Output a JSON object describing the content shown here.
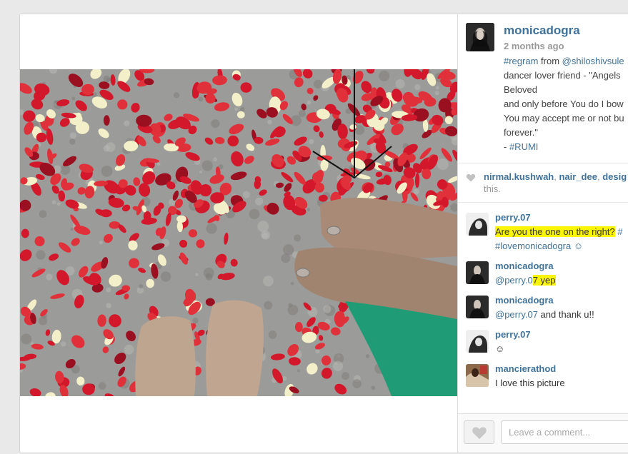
{
  "post": {
    "username": "monicadogra",
    "time_ago": "2 months ago",
    "caption": {
      "tag_regram": "#regram",
      "from_word": " from ",
      "from_user": "@shiloshivsule",
      "line2": "dancer lover friend - \"Angels",
      "line3": "Beloved",
      "line4": "and only before You do I bow",
      "line5": "You may accept me or not bu",
      "line6": "forever.\"",
      "line7_prefix": "- ",
      "tag_rumi": "#RUMI"
    }
  },
  "likes": {
    "user1": "nirmal.kushwah",
    "sep1": ", ",
    "user2": "nair_dee",
    "sep2": ", ",
    "user3": "desig",
    "suffix": "this."
  },
  "comments": [
    {
      "user": "perry.07",
      "text": "Are you the one on the right?",
      "text_after": " #",
      "line2": "#lovemonicadogra ☺"
    },
    {
      "user": "monicadogra",
      "mention": "@perry.0",
      "text": "7 yep"
    },
    {
      "user": "monicadogra",
      "mention": "@perry.07",
      "text": " and thank u!!"
    },
    {
      "user": "perry.07",
      "text": "☺"
    },
    {
      "user": "mancierathod",
      "text": "I love this picture"
    }
  ],
  "footer": {
    "comment_placeholder": "Leave a comment..."
  },
  "colors": {
    "link": "#3f729b",
    "highlight": "#fbf500",
    "petal_red": "#d2182a"
  }
}
